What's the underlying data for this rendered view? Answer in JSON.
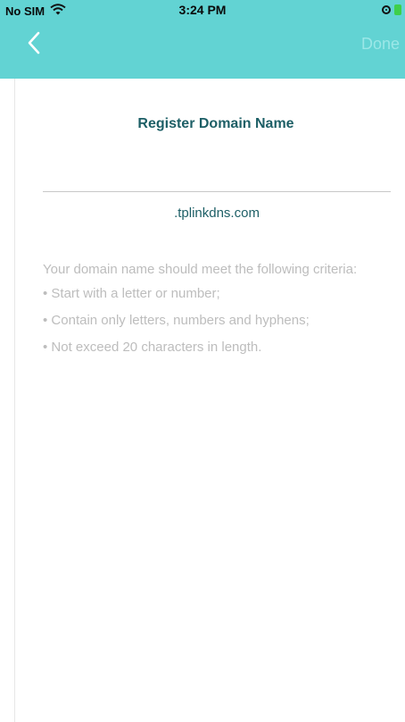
{
  "status_bar": {
    "carrier": "No SIM",
    "time": "3:24 PM"
  },
  "nav": {
    "done_label": "Done"
  },
  "page": {
    "title": "Register Domain Name",
    "input_value": "",
    "input_placeholder": "",
    "domain_suffix": ".tplinkdns.com"
  },
  "criteria": {
    "intro": "Your domain name should meet the following criteria:",
    "items": [
      "Start with a letter or number;",
      "Contain only letters, numbers and hyphens;",
      "Not exceed 20 characters in length."
    ]
  },
  "colors": {
    "header_bg": "#62d3d3",
    "title_text": "#1d5f66",
    "done_disabled": "#9be7e7",
    "hint_text": "#bdbdbd"
  },
  "icons": {
    "back": "chevron-left-icon",
    "wifi": "wifi-icon",
    "lock": "rotation-lock-icon",
    "battery": "battery-charging-icon"
  }
}
